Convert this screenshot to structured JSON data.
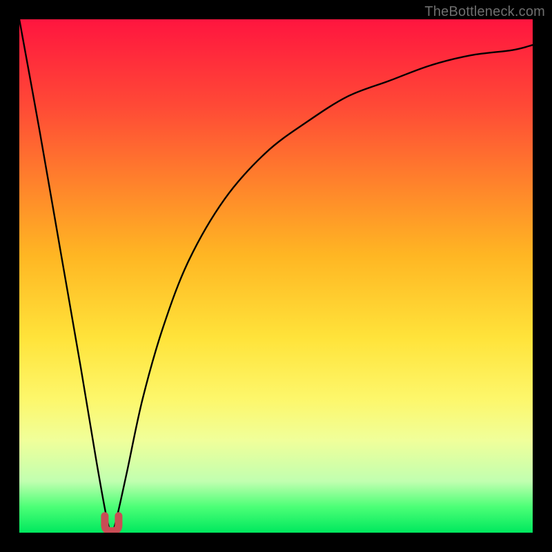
{
  "watermark": "TheBottleneck.com",
  "chart_data": {
    "type": "line",
    "title": "",
    "xlabel": "",
    "ylabel": "",
    "xlim": [
      0,
      1
    ],
    "ylim": [
      0,
      1
    ],
    "notch_x": 0.18,
    "series": [
      {
        "name": "curve",
        "x": [
          0.0,
          0.04,
          0.08,
          0.12,
          0.15,
          0.17,
          0.18,
          0.19,
          0.21,
          0.24,
          0.28,
          0.33,
          0.4,
          0.48,
          0.56,
          0.64,
          0.72,
          0.8,
          0.88,
          0.96,
          1.0
        ],
        "y": [
          1.0,
          0.78,
          0.55,
          0.32,
          0.14,
          0.03,
          0.0,
          0.03,
          0.12,
          0.26,
          0.4,
          0.53,
          0.65,
          0.74,
          0.8,
          0.85,
          0.88,
          0.91,
          0.93,
          0.94,
          0.95
        ]
      }
    ],
    "marker": {
      "x": 0.18,
      "y": 0.015,
      "color": "#c94d55",
      "radius_px": 10
    }
  }
}
